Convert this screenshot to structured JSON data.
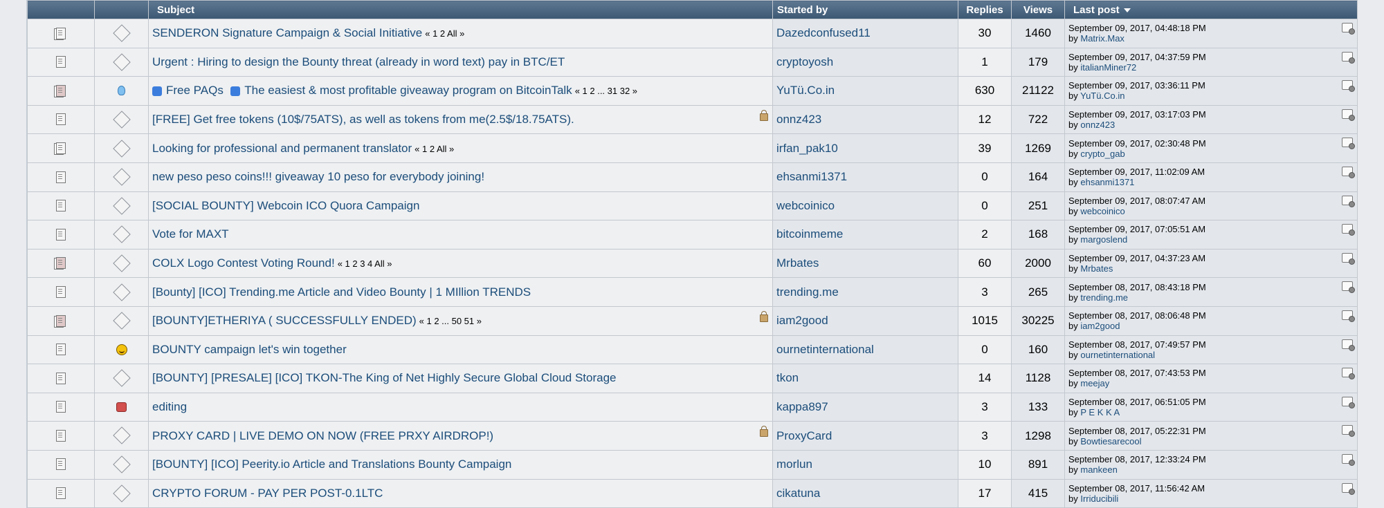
{
  "header": {
    "subject": "Subject",
    "started_by": "Started by",
    "replies": "Replies",
    "views": "Views",
    "last_post": "Last post"
  },
  "rows": [
    {
      "doc": "hot",
      "msg": "diamond",
      "subject": "SENDERON Signature Campaign & Social Initiative",
      "pages": "« 1 2  All »",
      "locked": false,
      "starter": "Dazedconfused11",
      "replies": "30",
      "views": "1460",
      "date": "September 09, 2017, 04:48:18 PM",
      "by": "by",
      "user": "Matrix.Max"
    },
    {
      "doc": "normal",
      "msg": "diamond",
      "subject": "Urgent : Hiring to design the Bounty threat (already in word text) pay in BTC/ET",
      "pages": "",
      "locked": false,
      "starter": "cryptoyosh",
      "replies": "1",
      "views": "179",
      "date": "September 09, 2017, 04:37:59 PM",
      "by": "by",
      "user": "italianMiner72"
    },
    {
      "doc": "very",
      "msg": "bulb",
      "subject_prefix": "Free PAQs",
      "subject": "The easiest & most profitable giveaway program on BitcoinTalk",
      "pages": "« 1 2 ... 31 32 »",
      "locked": false,
      "starter": "YuTü.Co.in",
      "replies": "630",
      "views": "21122",
      "date": "September 09, 2017, 03:36:11 PM",
      "by": "by",
      "user": "YuTü.Co.in"
    },
    {
      "doc": "normal",
      "msg": "diamond",
      "subject": "[FREE] Get free tokens (10$/75ATS), as well as tokens from me(2.5$/18.75ATS).",
      "pages": "",
      "locked": true,
      "starter": "onnz423",
      "replies": "12",
      "views": "722",
      "date": "September 09, 2017, 03:17:03 PM",
      "by": "by",
      "user": "onnz423"
    },
    {
      "doc": "hot",
      "msg": "diamond",
      "subject": "Looking for professional and permanent translator",
      "pages": "« 1 2  All »",
      "locked": false,
      "starter": "irfan_pak10",
      "replies": "39",
      "views": "1269",
      "date": "September 09, 2017, 02:30:48 PM",
      "by": "by",
      "user": "crypto_gab"
    },
    {
      "doc": "normal",
      "msg": "diamond",
      "subject": "new peso peso coins!!! giveaway 10 peso for everybody joining!",
      "pages": "",
      "locked": false,
      "starter": "ehsanmi1371",
      "replies": "0",
      "views": "164",
      "date": "September 09, 2017, 11:02:09 AM",
      "by": "by",
      "user": "ehsanmi1371"
    },
    {
      "doc": "normal",
      "msg": "diamond",
      "subject": "[SOCIAL BOUNTY] Webcoin ICO Quora Campaign",
      "pages": "",
      "locked": false,
      "starter": "webcoinico",
      "replies": "0",
      "views": "251",
      "date": "September 09, 2017, 08:07:47 AM",
      "by": "by",
      "user": "webcoinico"
    },
    {
      "doc": "normal",
      "msg": "diamond",
      "subject": "Vote for MAXT",
      "pages": "",
      "locked": false,
      "starter": "bitcoinmeme",
      "replies": "2",
      "views": "168",
      "date": "September 09, 2017, 07:05:51 AM",
      "by": "by",
      "user": "margoslend"
    },
    {
      "doc": "very",
      "msg": "diamond",
      "subject": "COLX Logo Contest Voting Round!",
      "pages": "« 1 2 3 4  All »",
      "locked": false,
      "starter": "Mrbates",
      "replies": "60",
      "views": "2000",
      "date": "September 09, 2017, 04:37:23 AM",
      "by": "by",
      "user": "Mrbates"
    },
    {
      "doc": "normal",
      "msg": "diamond",
      "subject": "[Bounty] [ICO] Trending.me Article and Video Bounty | 1 MIllion TRENDS",
      "pages": "",
      "locked": false,
      "starter": "trending.me",
      "replies": "3",
      "views": "265",
      "date": "September 08, 2017, 08:43:18 PM",
      "by": "by",
      "user": "trending.me"
    },
    {
      "doc": "very",
      "msg": "diamond",
      "subject": "[BOUNTY]ETHERIYA ( SUCCESSFULLY ENDED)",
      "pages": "« 1 2 ... 50 51 »",
      "locked": true,
      "starter": "iam2good",
      "replies": "1015",
      "views": "30225",
      "date": "September 08, 2017, 08:06:48 PM",
      "by": "by",
      "user": "iam2good"
    },
    {
      "doc": "normal",
      "msg": "smile",
      "subject": "BOUNTY campaign let's win together",
      "pages": "",
      "locked": false,
      "starter": "ournetinternational",
      "replies": "0",
      "views": "160",
      "date": "September 08, 2017, 07:49:57 PM",
      "by": "by",
      "user": "ournetinternational"
    },
    {
      "doc": "normal",
      "msg": "diamond",
      "subject": "[BOUNTY] [PRESALE] [ICO] TKON-The King of Net Highly Secure Global Cloud Storage",
      "pages": "",
      "locked": false,
      "starter": "tkon",
      "replies": "14",
      "views": "1128",
      "date": "September 08, 2017, 07:43:53 PM",
      "by": "by",
      "user": "meejay"
    },
    {
      "doc": "normal",
      "msg": "thumb",
      "subject": "editing",
      "pages": "",
      "locked": false,
      "starter": "kappa897",
      "replies": "3",
      "views": "133",
      "date": "September 08, 2017, 06:51:05 PM",
      "by": "by",
      "user": "P E K K A"
    },
    {
      "doc": "normal",
      "msg": "diamond",
      "subject": "PROXY CARD | LIVE DEMO ON NOW (FREE PRXY AIRDROP!)",
      "pages": "",
      "locked": true,
      "starter": "ProxyCard",
      "replies": "3",
      "views": "1298",
      "date": "September 08, 2017, 05:22:31 PM",
      "by": "by",
      "user": "Bowtiesarecool"
    },
    {
      "doc": "normal",
      "msg": "diamond",
      "subject": "[BOUNTY] [ICO] Peerity.io Article and Translations Bounty Campaign",
      "pages": "",
      "locked": false,
      "starter": "morlun",
      "replies": "10",
      "views": "891",
      "date": "September 08, 2017, 12:33:24 PM",
      "by": "by",
      "user": "mankeen"
    },
    {
      "doc": "normal",
      "msg": "diamond",
      "subject": "CRYPTO FORUM - PAY PER POST-0.1LTC",
      "pages": "",
      "locked": false,
      "starter": "cikatuna",
      "replies": "17",
      "views": "415",
      "date": "September 08, 2017, 11:56:42 AM",
      "by": "by",
      "user": "Irriducibili"
    }
  ]
}
